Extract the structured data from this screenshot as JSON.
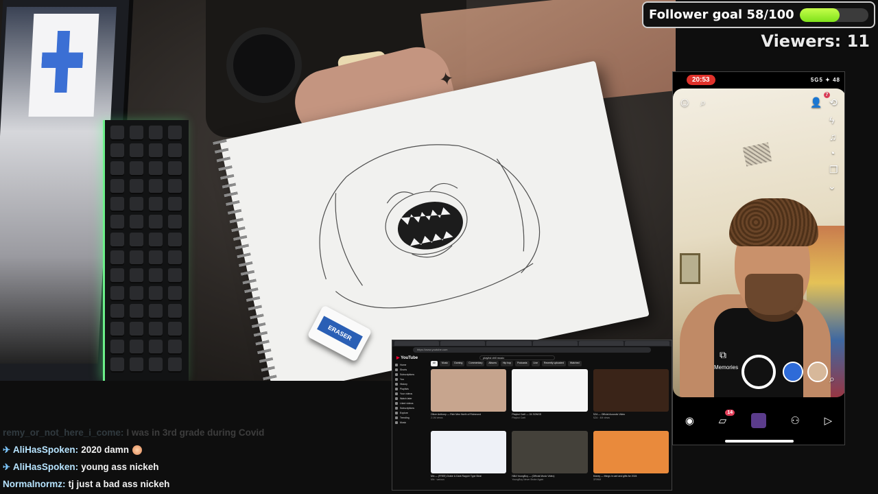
{
  "overlay": {
    "follower_goal_label": "Follower goal 58/100",
    "follower_goal_progress": 0.58,
    "viewers_label": "Viewers: 11",
    "accent_color": "#9ef02a"
  },
  "phone": {
    "time": "20:53",
    "status": "5G5 ✦ 48",
    "memories_label": "Memories",
    "notification_badge": "7",
    "chat_badge": "14",
    "accent_color": "#e0322b"
  },
  "desk": {
    "eraser_label": "ERASER"
  },
  "youtube": {
    "address": "https://www.youtube.com",
    "logo": "YouTube",
    "search_query": "playlist drill music",
    "chips": [
      "All",
      "Music",
      "Gaming",
      "Commentary",
      "Albums",
      "Hip hop",
      "Podcasts",
      "Live",
      "Recently uploaded",
      "Watched"
    ],
    "sidebar": [
      "Home",
      "Shorts",
      "Subscriptions",
      "You",
      "History",
      "Playlists",
      "Your videos",
      "Watch later",
      "Liked videos",
      "Subscriptions",
      "Explore",
      "Trending",
      "Music"
    ],
    "videos": [
      {
        "title": "Oliver Anthony — Rich Men North of Richmond",
        "meta": "2.1M views",
        "color": "#c7a58e"
      },
      {
        "title": "Playboi Carti — 24 SONGS",
        "meta": "Playboi Carti",
        "color": "#f5f5f5"
      },
      {
        "title": "SZA — Official Acoustic Video",
        "meta": "SZA · 4M views",
        "color": "#3a2418"
      },
      {
        "title": "Mix — (FREE) Drake & Dark Rapper Type Beat",
        "meta": "Mix · various",
        "color": "#eef1f7"
      },
      {
        "title": "NBA YoungBoy — (Official Music Video)",
        "meta": "YoungBoy Never Broke Again",
        "color": "#44413a"
      },
      {
        "title": "Money — things in cart and gifts for 2024",
        "meta": "GRWM",
        "color": "#e98a3c"
      }
    ]
  },
  "chat": [
    {
      "user": "remy_or_not_here_i_come:",
      "message": "I was in 3rd grade during Covid",
      "faded": true,
      "badge": ""
    },
    {
      "user": "AliHasSpoken:",
      "message": "2020 damn",
      "faded": false,
      "badge": "✈"
    },
    {
      "user": "AliHasSpoken:",
      "message": "young ass nickeh",
      "faded": false,
      "badge": "✈"
    },
    {
      "user": "Normalnormz:",
      "message": "tj just a bad ass nickeh",
      "faded": false,
      "badge": ""
    }
  ]
}
